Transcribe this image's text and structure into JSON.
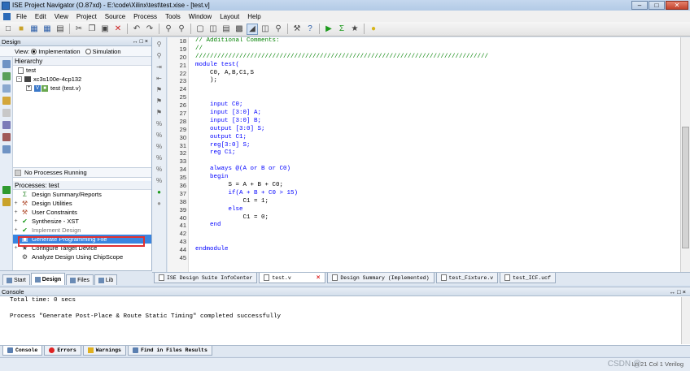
{
  "window": {
    "title": "ISE Project Navigator (O.87xd) - E:\\code\\Xilinx\\test\\test.xise - [test.v]",
    "controls": [
      "–",
      "□",
      "✕"
    ]
  },
  "menu": [
    "File",
    "Edit",
    "View",
    "Project",
    "Source",
    "Process",
    "Tools",
    "Window",
    "Layout",
    "Help"
  ],
  "design_panel": {
    "header": "Design",
    "header_buttons": "↔□×",
    "view_label": "View:",
    "view_impl": "Implementation",
    "view_sim": "Simulation",
    "hierarchy_title": "Hierarchy",
    "tree": [
      {
        "label": "test"
      },
      {
        "label": "xc3s100e-4cp132"
      },
      {
        "label": "test (test.v)"
      }
    ],
    "no_processes": "No Processes Running",
    "processes_title": "Processes: test",
    "processes": [
      {
        "label": "Design Summary/Reports",
        "expand": ""
      },
      {
        "label": "Design Utilities",
        "expand": "+"
      },
      {
        "label": "User Constraints",
        "expand": "+"
      },
      {
        "label": "Synthesize - XST",
        "expand": "+"
      },
      {
        "label": "Implement Design",
        "expand": "+"
      },
      {
        "label": "Generate Programming File",
        "expand": ""
      },
      {
        "label": "Configure Target Device",
        "expand": "+"
      },
      {
        "label": "Analyze Design Using ChipScope",
        "expand": ""
      }
    ],
    "tabs": [
      "Start",
      "Design",
      "Files",
      "Lib"
    ]
  },
  "editor": {
    "line_numbers": [
      "18",
      "19",
      "20",
      "21",
      "22",
      "23",
      "24",
      "25",
      "26",
      "27",
      "28",
      "29",
      "30",
      "31",
      "32",
      "33",
      "34",
      "35",
      "36",
      "37",
      "38",
      "39",
      "40",
      "41",
      "42",
      "43",
      "44",
      "45"
    ],
    "lines": [
      {
        "text": "// Additional Comments:",
        "color": "#008000"
      },
      {
        "text": "//",
        "color": "#008000"
      },
      {
        "text": "////////////////////////////////////////////////////////////////////////////////",
        "color": "#008000"
      },
      {
        "text": "module test(",
        "color": "#0000ff"
      },
      {
        "text": "    C0, A,B,C1,S",
        "color": "#000000"
      },
      {
        "text": "    );",
        "color": "#000000"
      },
      {
        "text": "",
        "color": "#000000"
      },
      {
        "text": "",
        "color": "#000000"
      },
      {
        "text": "    input C0;",
        "color": "#0000ff"
      },
      {
        "text": "    input [3:0] A;",
        "color": "#0000ff"
      },
      {
        "text": "    input [3:0] B;",
        "color": "#0000ff"
      },
      {
        "text": "    output [3:0] S;",
        "color": "#0000ff"
      },
      {
        "text": "    output C1;",
        "color": "#0000ff"
      },
      {
        "text": "    reg[3:0] S;",
        "color": "#0000ff"
      },
      {
        "text": "    reg C1;",
        "color": "#0000ff"
      },
      {
        "text": "",
        "color": "#000000"
      },
      {
        "text": "    always @(A or B or C0)",
        "color": "#0000ff"
      },
      {
        "text": "    begin",
        "color": "#0000ff"
      },
      {
        "text": "         S = A + B + C0;",
        "color": "#000000"
      },
      {
        "text": "         if(A + B + C0 > 15)",
        "color": "#0000ff"
      },
      {
        "text": "             C1 = 1;",
        "color": "#000000"
      },
      {
        "text": "         else",
        "color": "#0000ff"
      },
      {
        "text": "             C1 = 0;",
        "color": "#000000"
      },
      {
        "text": "    end",
        "color": "#0000ff"
      },
      {
        "text": "",
        "color": "#000000"
      },
      {
        "text": "",
        "color": "#000000"
      },
      {
        "text": "endmodule",
        "color": "#0000ff"
      },
      {
        "text": "",
        "color": "#000000"
      }
    ]
  },
  "doc_tabs": [
    {
      "label": "ISE Design Suite InfoCenter",
      "active": false,
      "close": ""
    },
    {
      "label": "test.v",
      "active": true,
      "close": "×"
    },
    {
      "label": "Design Summary (Implemented)",
      "active": false,
      "close": ""
    },
    {
      "label": "test_Fixture.v",
      "active": false,
      "close": ""
    },
    {
      "label": "test_ICF.ucf",
      "active": false,
      "close": ""
    }
  ],
  "console": {
    "header": "Console",
    "lines": [
      "Total time: 0 secs",
      "",
      "Process \"Generate Post-Place & Route Static Timing\" completed successfully",
      "",
      ""
    ],
    "tabs": [
      "Console",
      "Errors",
      "Warnings",
      "Find in Files Results"
    ]
  },
  "status": {
    "position": "Ln 21 Col 1  Verilog",
    "watermark": "CSDN @"
  },
  "colors": {
    "selection": "#3a85e0",
    "highlight_box": "#e23030"
  }
}
